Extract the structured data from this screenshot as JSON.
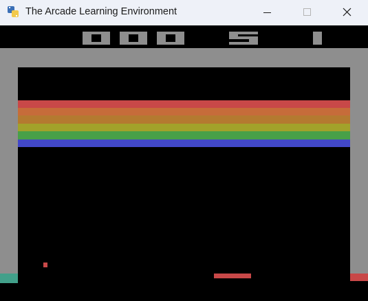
{
  "window": {
    "title": "The Arcade Learning Environment",
    "app_icon": "python-icon",
    "controls": {
      "minimize_icon": "minimize-icon",
      "maximize_icon": "maximize-icon",
      "close_icon": "close-icon"
    }
  },
  "game": {
    "name": "Breakout",
    "score": 0,
    "score_display": "000",
    "lives": 5,
    "player": 1,
    "colors": {
      "background": "#000000",
      "wall": "#8e8e8e",
      "paddle": "#c84848",
      "ball": "#c84848",
      "left_wall_tip": "#42a08a",
      "right_wall_tip": "#c84848"
    },
    "brick_rows": [
      {
        "row": 1,
        "color": "#c84848"
      },
      {
        "row": 2,
        "color": "#c66c3a"
      },
      {
        "row": 3,
        "color": "#b47a30"
      },
      {
        "row": 4,
        "color": "#a2a22a"
      },
      {
        "row": 5,
        "color": "#48a048"
      },
      {
        "row": 6,
        "color": "#4248c8"
      }
    ]
  }
}
